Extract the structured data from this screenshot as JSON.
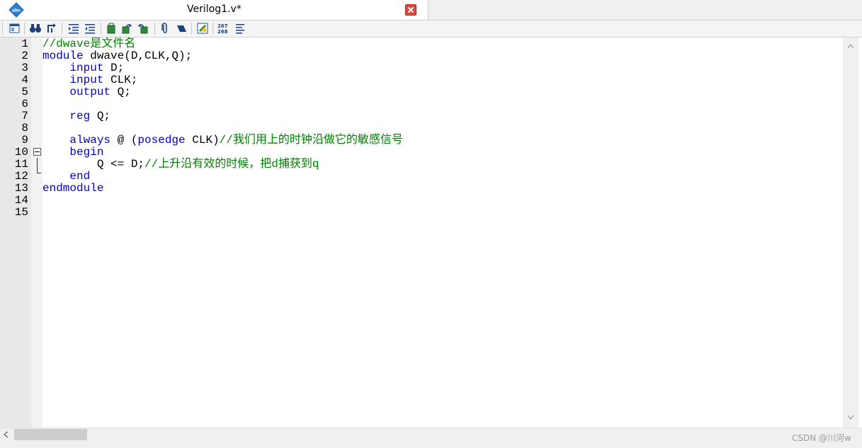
{
  "tab": {
    "title": "Verilog1.v*",
    "app_icon_text": "abc"
  },
  "toolbar": {
    "buttons": [
      "window-layout-icon",
      "binoculars-icon",
      "find-next-icon",
      "indent-icon",
      "outdent-icon",
      "bookmark-icon",
      "bookmark-prev-icon",
      "bookmark-next-icon",
      "paperclip-icon",
      "marker-icon",
      "column-select-icon",
      "line-number-icon",
      "word-wrap-icon"
    ],
    "line_number_icon_text": [
      "267",
      "268"
    ]
  },
  "editor": {
    "line_numbers": [
      "1",
      "2",
      "3",
      "4",
      "5",
      "6",
      "7",
      "8",
      "9",
      "10",
      "11",
      "12",
      "13",
      "14",
      "15"
    ],
    "lines": [
      [
        {
          "t": "//dwave是文件名",
          "c": "cm"
        }
      ],
      [
        {
          "t": "module",
          "c": "kw"
        },
        {
          "t": " dwave(D,CLK,Q);",
          "c": "tx"
        }
      ],
      [
        {
          "t": "    ",
          "c": "tx"
        },
        {
          "t": "input",
          "c": "kw"
        },
        {
          "t": " D;",
          "c": "tx"
        }
      ],
      [
        {
          "t": "    ",
          "c": "tx"
        },
        {
          "t": "input",
          "c": "kw"
        },
        {
          "t": " CLK;",
          "c": "tx"
        }
      ],
      [
        {
          "t": "    ",
          "c": "tx"
        },
        {
          "t": "output",
          "c": "kw"
        },
        {
          "t": " Q;",
          "c": "tx"
        }
      ],
      [],
      [
        {
          "t": "    ",
          "c": "tx"
        },
        {
          "t": "reg",
          "c": "kw"
        },
        {
          "t": " Q;",
          "c": "tx"
        }
      ],
      [],
      [
        {
          "t": "    ",
          "c": "tx"
        },
        {
          "t": "always",
          "c": "kw"
        },
        {
          "t": " @ (",
          "c": "tx"
        },
        {
          "t": "posedge",
          "c": "kw"
        },
        {
          "t": " CLK)",
          "c": "tx"
        },
        {
          "t": "//我们用上的时钟沿做它的敏感信号",
          "c": "cm"
        }
      ],
      [
        {
          "t": "    ",
          "c": "tx"
        },
        {
          "t": "begin",
          "c": "kw"
        }
      ],
      [
        {
          "t": "        Q <= D;",
          "c": "tx"
        },
        {
          "t": "//上升沿有效的时候，把d捕获到q",
          "c": "cm"
        }
      ],
      [
        {
          "t": "    ",
          "c": "tx"
        },
        {
          "t": "end",
          "c": "kw"
        }
      ],
      [
        {
          "t": "endmodule",
          "c": "kw"
        }
      ],
      [],
      []
    ]
  },
  "watermark": "CSDN @川河w",
  "colors": {
    "keyword": "#0000c8",
    "comment": "#008000",
    "text": "#000000"
  }
}
